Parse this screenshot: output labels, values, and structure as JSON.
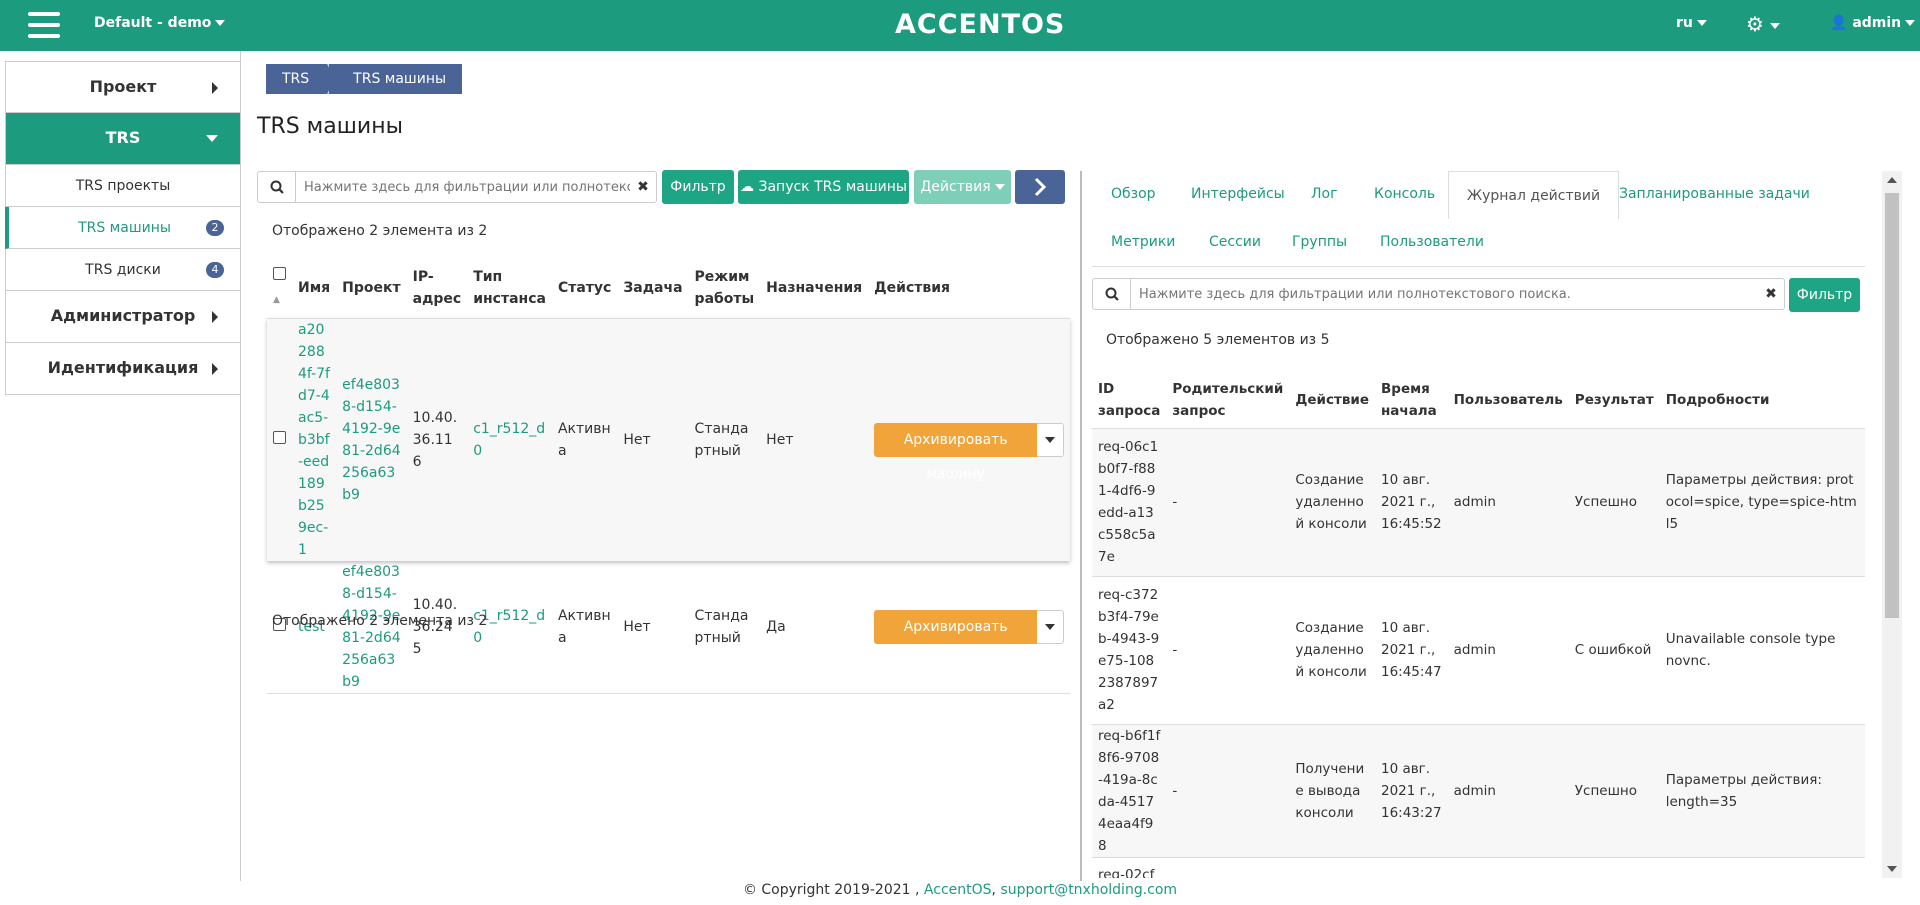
{
  "topbar": {
    "project": "Default - demo",
    "logo": "ACCENTOS",
    "lang": "ru",
    "user": "admin"
  },
  "sidebar": {
    "items": [
      {
        "label": "Проект"
      },
      {
        "label": "TRS"
      },
      {
        "label": "Администратор"
      },
      {
        "label": "Идентификация"
      }
    ],
    "sub": [
      {
        "label": "TRS проекты"
      },
      {
        "label": "TRS машины",
        "badge": "2"
      },
      {
        "label": "TRS диски",
        "badge": "4"
      }
    ]
  },
  "breadcrumb": [
    "TRS",
    "TRS машины"
  ],
  "page_title": "TRS машины",
  "left": {
    "search_placeholder": "Нажмите здесь для фильтрации или полнотекстов...",
    "filter_btn": "Фильтр",
    "launch_btn": "Запуск TRS машины",
    "actions_btn": "Действия",
    "count_top": "Отображено 2 элемента из 2",
    "count_bottom": "Отображено 2 элемента из 2",
    "headers": [
      "Имя",
      "Проект",
      "IP-адрес",
      "Тип инстанса",
      "Статус",
      "Задача",
      "Режим работы",
      "Назначения",
      "Действия"
    ],
    "rows": [
      {
        "name": "a202884f-7fd7-4ac5-b3bf-eed189b259ec-1",
        "project": "ef4e8038-d154-4192-9e81-2d64256a63b9",
        "ip": "10.40.36.116",
        "type": "c1_r512_d0",
        "status": "Активна",
        "task": "Нет",
        "mode": "Стандартный",
        "assign": "Нет",
        "action": "Архивировать машину"
      },
      {
        "name": "test",
        "project": "ef4e8038-d154-4192-9e81-2d64256a63b9",
        "ip": "10.40.36.245",
        "type": "c1_r512_d0",
        "status": "Активна",
        "task": "Нет",
        "mode": "Стандартный",
        "assign": "Да",
        "action": "Архивировать машину"
      }
    ]
  },
  "right": {
    "tabs": [
      "Обзор",
      "Интерфейсы",
      "Лог",
      "Консоль",
      "Журнал действий",
      "Запланированные задачи",
      "Метрики",
      "Сессии",
      "Группы",
      "Пользователи"
    ],
    "active_tab": "Журнал действий",
    "search_placeholder": "Нажмите здесь для фильтрации или полнотекстового поиска.",
    "filter_btn": "Фильтр",
    "count": "Отображено 5 элементов из 5",
    "headers": [
      "ID запроса",
      "Родительский запрос",
      "Действие",
      "Время начала",
      "Пользователь",
      "Результат",
      "Подробности"
    ],
    "rows": [
      {
        "id": "req-06c1b0f7-f881-4df6-9edd-a13c558c5a7e",
        "parent": "-",
        "action": "Создание удаленной консоли",
        "time": "10 авг. 2021 г., 16:45:52",
        "user": "admin",
        "result": "Успешно",
        "details": "Параметры действия: protocol=spice, type=spice-html5"
      },
      {
        "id": "req-c372b3f4-79eb-4943-9e75-1082387897a2",
        "parent": "-",
        "action": "Создание удаленной консоли",
        "time": "10 авг. 2021 г., 16:45:47",
        "user": "admin",
        "result": "С ошибкой",
        "details": "Unavailable console type novnc."
      },
      {
        "id": "req-b6f1f8f6-9708-419a-8cda-45174eaa4f98",
        "parent": "-",
        "action": "Получение вывода консоли",
        "time": "10 авг. 2021 г., 16:43:27",
        "user": "admin",
        "result": "Успешно",
        "details": "Параметры действия: length=35"
      },
      {
        "id": "req-02cf",
        "parent": "",
        "action": "",
        "time": "",
        "user": "",
        "result": "",
        "details": ""
      }
    ]
  },
  "footer": {
    "copyright": "© Copyright 2019-2021 ,",
    "brand": "AccentOS",
    "sep": ",",
    "email": "support@tnxholding.com"
  }
}
